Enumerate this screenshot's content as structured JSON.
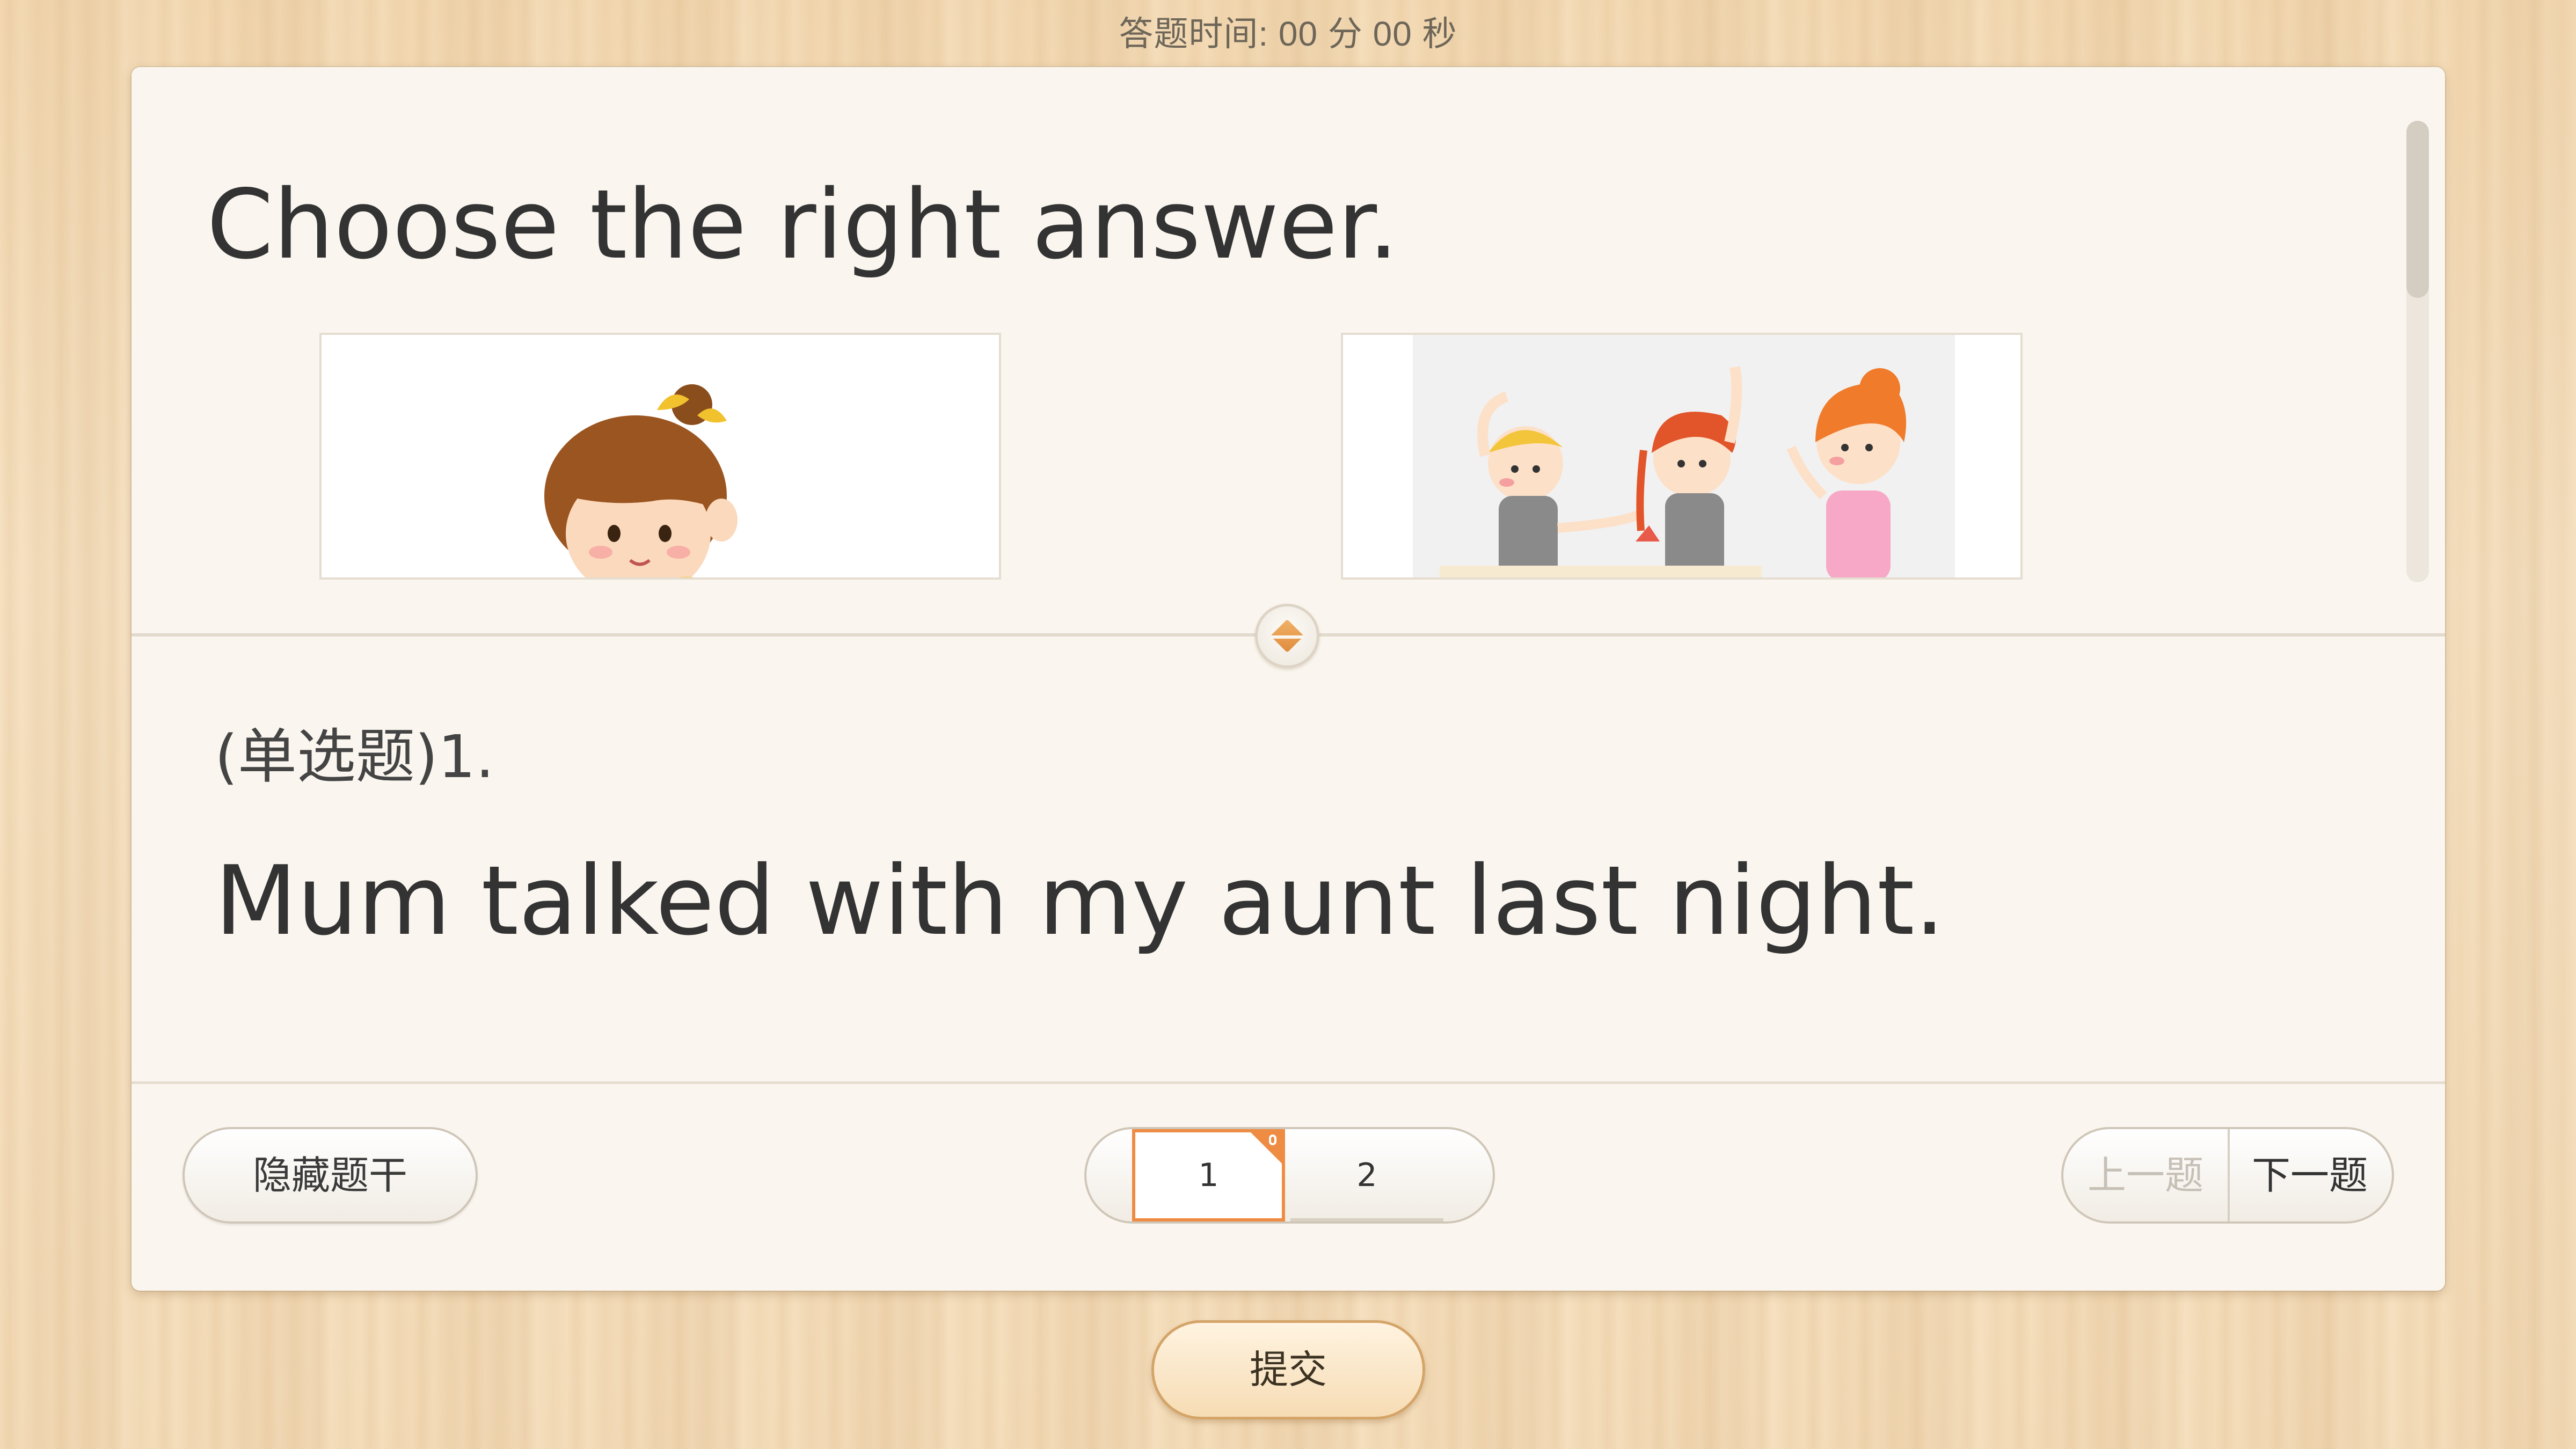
{
  "timer": {
    "text": "答题时间:  00 分 00 秒"
  },
  "stem": {
    "instruction": "Choose the right answer.",
    "images": [
      {
        "name": "girl-illustration"
      },
      {
        "name": "ballet-girls-illustration"
      }
    ]
  },
  "question": {
    "type_label": "(单选题)1.",
    "sentence": "Mum talked with my aunt last night."
  },
  "toolbar": {
    "hide_stem_label": "隐藏题干",
    "pages": [
      "1",
      "2"
    ],
    "current_page": 1,
    "prev_label": "上一题",
    "next_label": "下一题"
  },
  "submit": {
    "label": "提交"
  },
  "colors": {
    "accent": "#ef8c43",
    "panel": "#faf6ef",
    "background": "#f3dab6"
  },
  "icons": {
    "splitter": "splitter-handle-icon",
    "page_flag": "bookmark-flag-icon"
  }
}
